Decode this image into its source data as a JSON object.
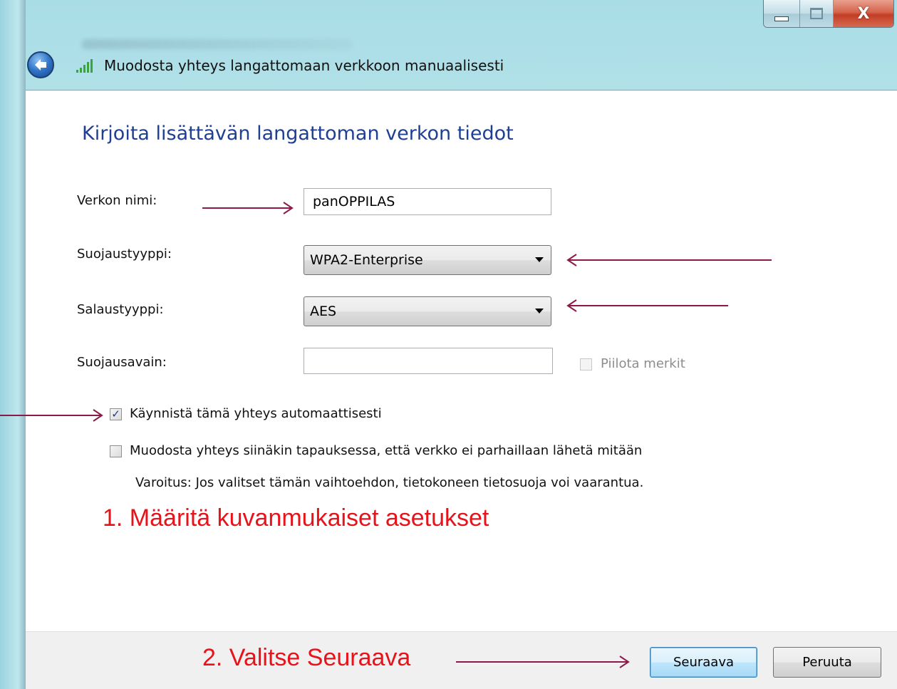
{
  "window": {
    "title": "Muodosta yhteys langattomaan verkkoon manuaalisesti",
    "close_glyph": "X",
    "icons": [
      "back-arrow-icon",
      "wireless-signal-icon",
      "minimize-icon",
      "maximize-icon",
      "close-icon"
    ]
  },
  "form": {
    "heading": "Kirjoita lisättävän langattoman verkon tiedot",
    "network_name_label": "Verkon nimi:",
    "network_name_value": "panOPPILAS",
    "security_type_label": "Suojaustyyppi:",
    "security_type_value": "WPA2-Enterprise",
    "encryption_type_label": "Salaustyyppi:",
    "encryption_type_value": "AES",
    "security_key_label": "Suojausavain:",
    "security_key_value": "",
    "hide_characters_label": "Piilota merkit",
    "hide_characters_checked": false,
    "auto_start_label": "Käynnistä tämä yhteys automaattisesti",
    "auto_start_checked": true,
    "connect_even_if_label": "Muodosta yhteys siinäkin tapauksessa, että verkko ei parhaillaan lähetä mitään",
    "connect_even_if_checked": false,
    "warning_text": "Varoitus: Jos valitset tämän vaihtoehdon, tietokoneen tietosuoja voi vaarantua."
  },
  "annotations": {
    "step1": "1. Määritä kuvanmukaiset asetukset",
    "step2": "2. Valitse Seuraava",
    "arrow_color": "#8b1a4a",
    "text_color": "#e8121b"
  },
  "buttons": {
    "next": "Seuraava",
    "cancel": "Peruuta"
  },
  "colors": {
    "heading": "#1f3f94",
    "frame": "#b4e1ea"
  }
}
